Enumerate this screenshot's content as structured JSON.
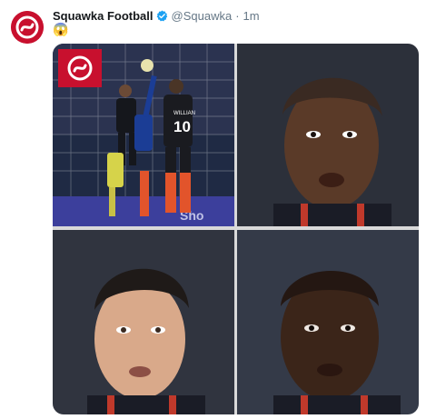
{
  "tweet": {
    "author_name": "Squawka Football",
    "handle": "@Squawka",
    "separator": "·",
    "time": "1m",
    "text": "😱"
  },
  "icons": {
    "avatar": "squawka-logo",
    "verified": "verified-badge-icon",
    "watermark": "squawka-logo"
  },
  "colors": {
    "brand": "#c8102e",
    "verified": "#1da1f2",
    "muted": "#657786"
  },
  "media": {
    "photo1_label": "Chelsea players in match action, number 10 jersey reading WILLIAN",
    "photo1_jersey_name": "WILLIAN",
    "photo1_jersey_number": "10"
  }
}
